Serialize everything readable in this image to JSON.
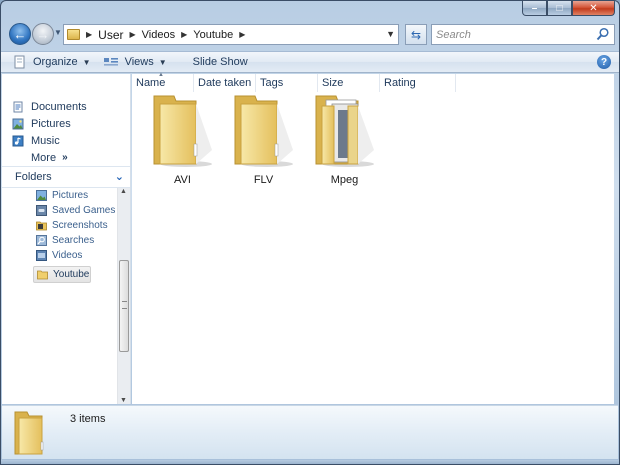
{
  "address": {
    "crumbs": [
      "User",
      "Videos",
      "Youtube"
    ]
  },
  "search": {
    "placeholder": "Search"
  },
  "toolbar": {
    "organize_label": "Organize",
    "views_label": "Views",
    "slideshow_label": "Slide Show"
  },
  "navpane": {
    "favorites": [
      {
        "label": "Documents",
        "icon": "documents-icon"
      },
      {
        "label": "Pictures",
        "icon": "pictures-icon"
      },
      {
        "label": "Music",
        "icon": "music-icon"
      }
    ],
    "more_label": "More",
    "folders_label": "Folders",
    "tree": [
      {
        "label": "Pictures",
        "icon": "pictures-icon"
      },
      {
        "label": "Saved Games",
        "icon": "saved-games-icon"
      },
      {
        "label": "Screenshots",
        "icon": "folder-icon"
      },
      {
        "label": "Searches",
        "icon": "searches-icon"
      },
      {
        "label": "Videos",
        "icon": "videos-icon"
      },
      {
        "label": "Youtube",
        "icon": "folder-icon",
        "selected": true
      }
    ]
  },
  "columns": [
    "Name",
    "Date taken",
    "Tags",
    "Size",
    "Rating"
  ],
  "items": [
    {
      "label": "AVI",
      "icon": "folder-icon"
    },
    {
      "label": "FLV",
      "icon": "folder-icon"
    },
    {
      "label": "Mpeg",
      "icon": "folder-with-files-icon"
    }
  ],
  "details": {
    "count_text": "3 items"
  },
  "colors": {
    "link_text": "#1e395b",
    "folder_yellow": "#f2d478",
    "nav_back_blue": "#2f74c0",
    "close_red": "#c23b1d"
  }
}
